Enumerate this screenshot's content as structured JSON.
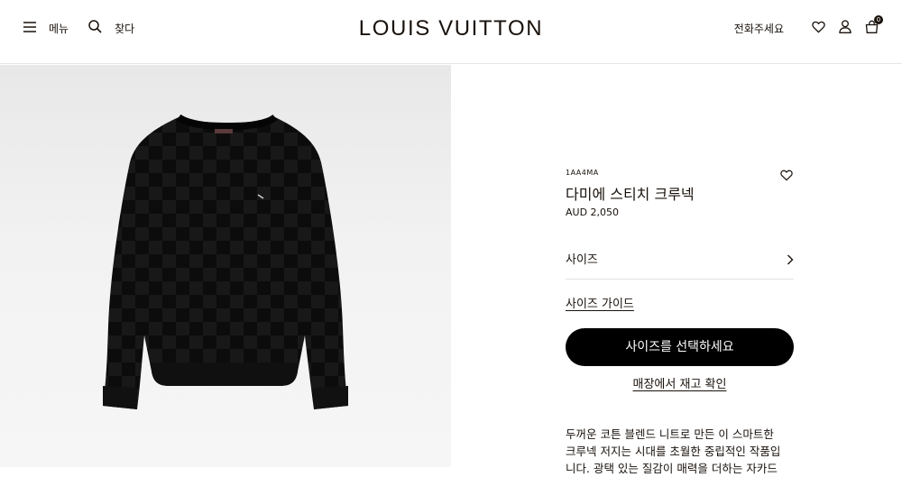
{
  "header": {
    "menu_label": "메뉴",
    "search_label": "찾다",
    "logo": "LOUIS VUITTON",
    "call_label": "전화주세요",
    "cart_count": "0"
  },
  "product": {
    "sku": "1AA4MA",
    "name": "다미에 스티치 크루넥",
    "price": "AUD 2,050",
    "size_label": "사이즈",
    "size_guide": "사이즈 가이드",
    "cta_label": "사이즈를 선택하세요",
    "stock_check": "매장에서 재고 확인",
    "description_line1": "두꺼운 코튼 블렌드 니트로 만든 이 스마트한",
    "description_line2": "크루넥 저지는 시대를 초월한 중립적인 작품입",
    "description_line3": "니다. 광택 있는 질감이 매력을 더하는 자카드"
  },
  "colors": {
    "text": "#19110b",
    "button_bg": "#000000",
    "divider": "#e1e1e1"
  },
  "icons": {
    "menu": "hamburger-icon",
    "search": "search-icon",
    "wishlist": "heart-icon",
    "account": "user-icon",
    "cart": "shopping-bag-icon",
    "size_chevron": "chevron-right-icon"
  }
}
